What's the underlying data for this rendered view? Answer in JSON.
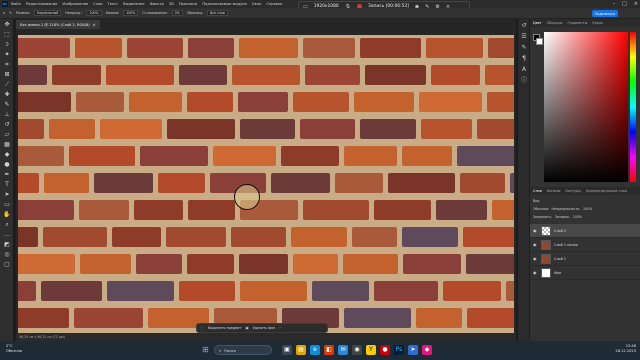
{
  "menubar": {
    "items": [
      "Файл",
      "Редактирование",
      "Изображение",
      "Слои",
      "Текст",
      "Выделение",
      "Фильтр",
      "3D",
      "Просмотр",
      "Подключаемые модули",
      "Окно",
      "Справка"
    ]
  },
  "recording": {
    "resolution": "1920x1080",
    "label": "Запись [00:06:53]"
  },
  "options": {
    "size_label": "Размер:",
    "mode_value": "Нормальный",
    "opacity_label": "Непрозр.:",
    "opacity_value": "100%",
    "pressure_label": "Нажим:",
    "pressure_value": "100%",
    "smooth_label": "Сглаживание:",
    "smooth_value": "0%",
    "sample_label": "Образец:",
    "sample_value": "Все слои",
    "share_label": "Поделиться"
  },
  "document": {
    "tab_title": "Без имени-1 @ 218% (Слой 2, RGB/8)",
    "close": "×"
  },
  "canvas": {
    "status": "96,20 см x 96,25 см (72 ppi)"
  },
  "context_bar": {
    "select_subject": "Выделить предмет",
    "remove_bg": "Удалить фон"
  },
  "panels": {
    "color_tabs": [
      "Цвет",
      "Образцы",
      "Градиенты",
      "Узоры"
    ],
    "layers_tabs": [
      "Слои",
      "Каналы",
      "Контуры",
      "Корректирующие слои"
    ],
    "blend_mode": "Обычные",
    "opacity_label": "Непрозрачность:",
    "opacity_value": "100%",
    "fill_label": "Заливка:",
    "fill_value": "100%",
    "lock_label": "Закрепить:",
    "kind_label": "Вид",
    "layers": [
      {
        "name": "Слой 2",
        "selected": true
      },
      {
        "name": "Слой 1 копия",
        "selected": false
      },
      {
        "name": "Слой 1",
        "selected": false
      },
      {
        "name": "Фон",
        "selected": false
      }
    ]
  },
  "taskbar": {
    "weather_temp": "2°C",
    "weather_desc": "Облачно",
    "search_placeholder": "Поиск",
    "time": "23:48",
    "date": "28.12.2023"
  },
  "colors": {
    "accent": "#1473e6",
    "canvas_bg": "#c9ac85"
  }
}
